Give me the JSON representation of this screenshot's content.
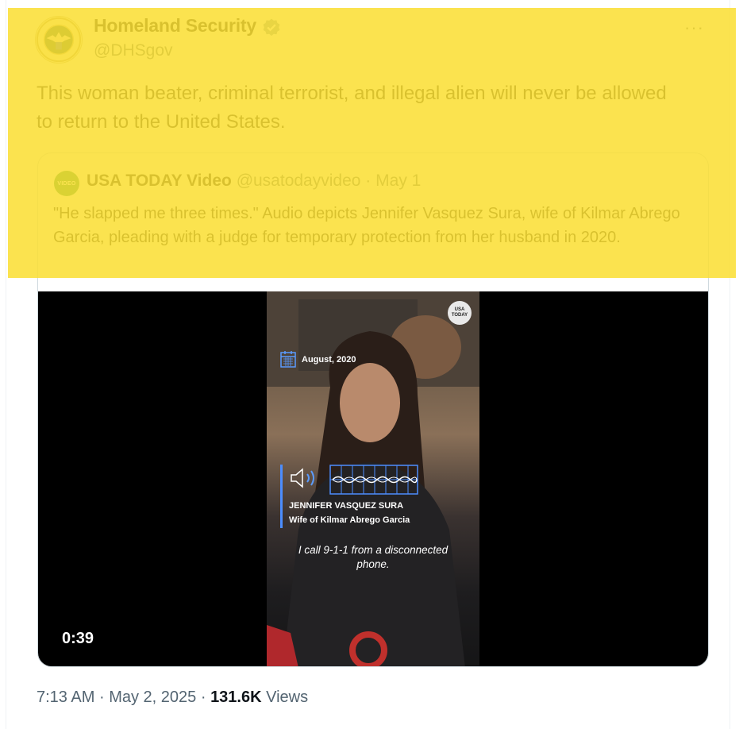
{
  "tweet": {
    "display_name": "Homeland Security",
    "handle": "@DHSgov",
    "more_label": "···",
    "text": "This woman beater, criminal terrorist, and illegal alien will never be allowed to return to the United States.",
    "verified_color": "#829aab"
  },
  "quote": {
    "avatar_label": "VIDEO",
    "name": "USA TODAY Video",
    "handle": "@usatodayvideo",
    "separator": "·",
    "date": "May 1",
    "text": "\"He slapped me three times.\" Audio depicts Jennifer Vasquez Sura, wife of Kilmar Abrego Garcia, pleading with a judge for temporary protection from her husband in 2020."
  },
  "video": {
    "duration": "0:39",
    "overlay_date": "August, 2020",
    "logo_text": "USA TODAY",
    "person_name": "JENNIFER VASQUEZ SURA",
    "person_title": "Wife of Kilmar Abrego Garcia",
    "caption": "I call 9-1-1 from a disconnected phone."
  },
  "footer": {
    "time": "7:13 AM",
    "date": "May 2, 2025",
    "views_count": "131.6K",
    "views_label": "Views"
  },
  "colors": {
    "highlight": "#fade32",
    "text": "#0f1419",
    "muted": "#536471",
    "accent": "#4c8dff"
  }
}
